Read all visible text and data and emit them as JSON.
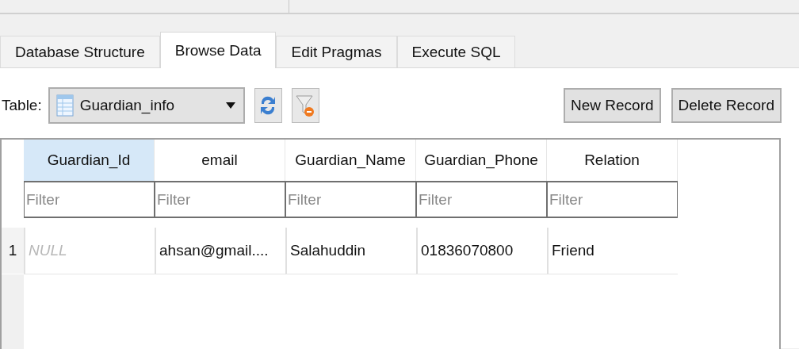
{
  "tabs": [
    {
      "label": "Database Structure",
      "selected": false
    },
    {
      "label": "Browse Data",
      "selected": true
    },
    {
      "label": "Edit Pragmas",
      "selected": false
    },
    {
      "label": "Execute SQL",
      "selected": false
    }
  ],
  "toolbar": {
    "table_label": "Table:",
    "table_select": "Guardian_info",
    "buttons": [
      "New Record",
      "Delete Record"
    ]
  },
  "table": {
    "columns": [
      {
        "label": "Guardian_Id",
        "selected": true,
        "filter_placeholder": "Filter"
      },
      {
        "label": "email",
        "selected": false,
        "filter_placeholder": "Filter"
      },
      {
        "label": "Guardian_Name",
        "selected": false,
        "filter_placeholder": "Filter"
      },
      {
        "label": "Guardian_Phone",
        "selected": false,
        "filter_placeholder": "Filter"
      },
      {
        "label": "Relation",
        "selected": false,
        "filter_placeholder": "Filter"
      }
    ],
    "rows": [
      {
        "number": "1",
        "cells": [
          {
            "text": "NULL",
            "kind": "null"
          },
          {
            "text": "ahsan@gmail....",
            "kind": "value"
          },
          {
            "text": "Salahuddin",
            "kind": "value"
          },
          {
            "text": "01836070800",
            "kind": "value"
          },
          {
            "text": "Friend",
            "kind": "value"
          }
        ]
      }
    ]
  }
}
